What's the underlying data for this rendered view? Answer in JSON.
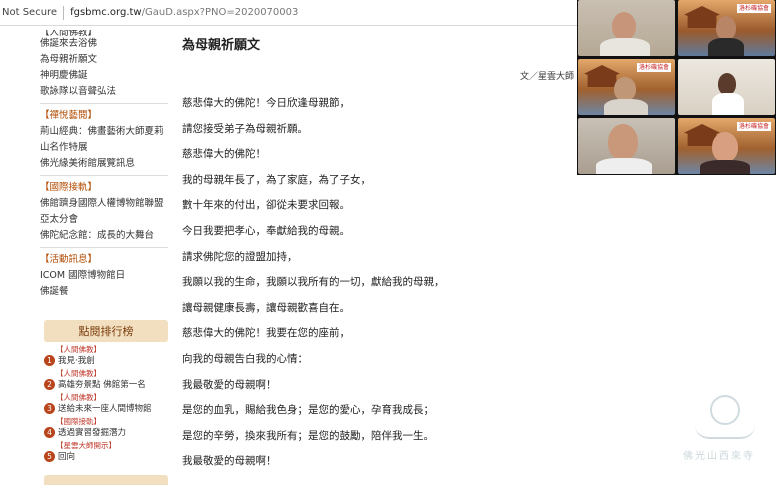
{
  "browser": {
    "security_label": "Not Secure",
    "url_host": "fgsbmc.org.tw",
    "url_path": "/GauD.aspx?PNO=2020070003"
  },
  "sidebar": {
    "cut_item": "【人間佛教】",
    "items_top": [
      "佛誕來去浴佛",
      "為母親祈願文",
      "神明慶佛誕",
      "歌詠隊以音聲弘法"
    ],
    "sections": [
      {
        "heading": "【禪悅藝閱】",
        "items": [
          "荊山經典：佛畫藝術大師夏莉",
          "山名作特展",
          "佛光緣美術館展覽訊息"
        ]
      },
      {
        "heading": "【國際接軌】",
        "items": [
          "佛館躋身國際人權博物館聯盟",
          "亞太分會",
          "佛陀紀念館：成長的大舞台"
        ]
      },
      {
        "heading": "【活動訊息】",
        "items": [
          "ICOM 國際博物館日",
          "佛誕餐"
        ]
      }
    ]
  },
  "ranking": {
    "title": "點閱排行榜",
    "items": [
      {
        "num": "1",
        "tag": "【人間佛教】",
        "title": "我見‧我創"
      },
      {
        "num": "2",
        "tag": "【人間佛教】",
        "title": "高雄夯景點 佛館第一名"
      },
      {
        "num": "3",
        "tag": "【人間佛教】",
        "title": "送給未來一座人間博物館"
      },
      {
        "num": "4",
        "tag": "【國際接軌】",
        "title": "透過實習發掘潛力"
      },
      {
        "num": "5",
        "tag": "【星雲大師開示】",
        "title": "回向"
      }
    ]
  },
  "article": {
    "title": "為母親祈願文",
    "author": "文／星雲大師",
    "lines": [
      "慈悲偉大的佛陀！今日欣逢母親節，",
      "請您接受弟子為母親祈願。",
      "慈悲偉大的佛陀！",
      "我的母親年長了，為了家庭，為了子女，",
      "數十年來的付出，卻從未要求回報。",
      "今日我要把孝心，奉獻給我的母親。",
      "請求佛陀您的證盟加持，",
      "我願以我的生命，我願以我所有的一切，獻給我的母親，",
      "讓母親健康長壽，讓母親歡喜自在。",
      "慈悲偉大的佛陀！我要在您的座前，",
      "向我的母親告白我的心情：",
      "我最敬愛的母親啊！",
      "是您的血乳，賜給我色身；是您的愛心，孕育我成長；",
      "是您的辛勞，換來我所有；是您的鼓勵，陪伴我一生。",
      "我最敬愛的母親啊！"
    ]
  },
  "video": {
    "banner_text": "洛杉磯協會"
  },
  "watermark": {
    "text": "佛光山西來寺"
  },
  "colors": {
    "heading_accent": "#b04a00",
    "rank_badge": "#b8441c",
    "rank_header_bg": "#f2dfbf"
  }
}
